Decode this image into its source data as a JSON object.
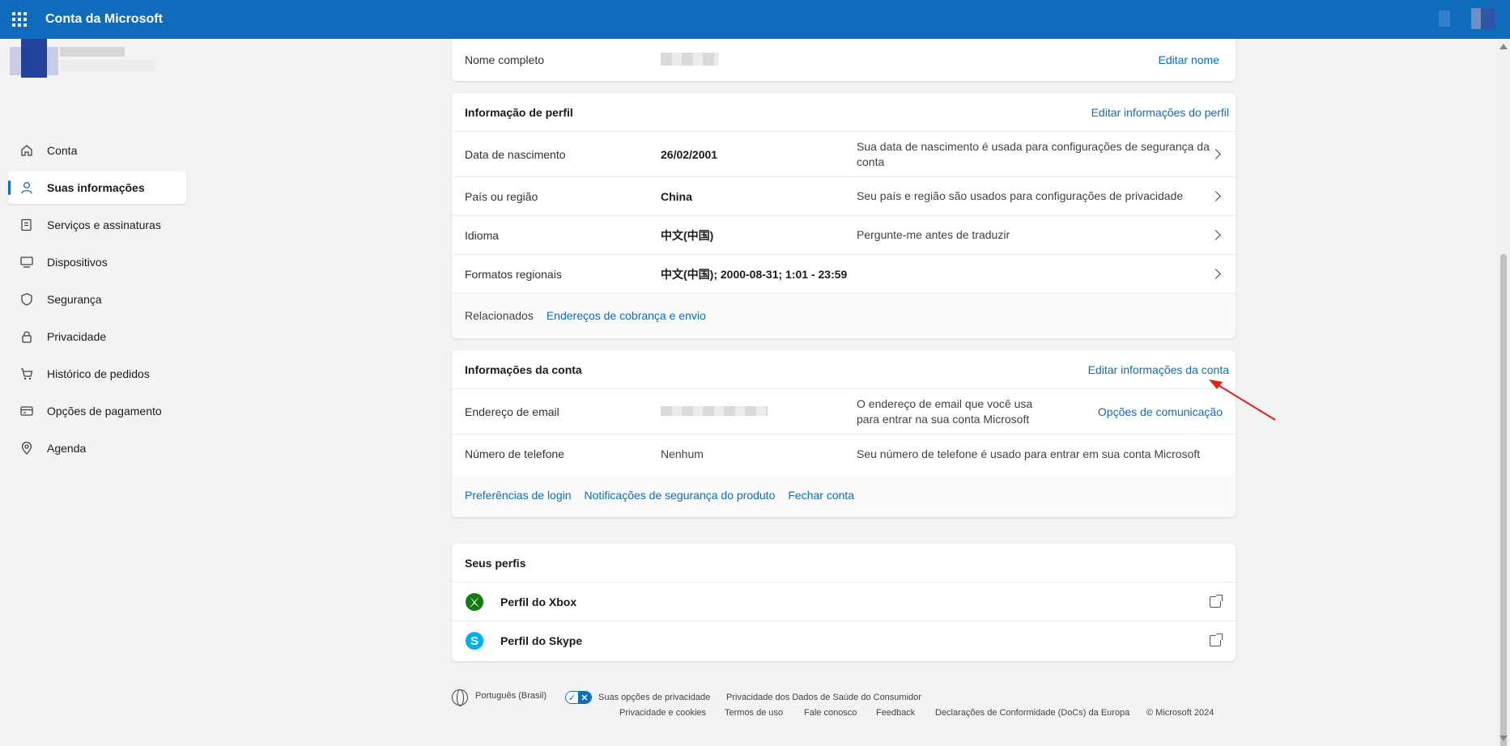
{
  "header": {
    "title": "Conta da Microsoft"
  },
  "sidebar": {
    "items": [
      {
        "label": "Conta",
        "icon": "home-icon"
      },
      {
        "label": "Suas informações",
        "icon": "person-icon",
        "active": true
      },
      {
        "label": "Serviços e assinaturas",
        "icon": "receipt-icon"
      },
      {
        "label": "Dispositivos",
        "icon": "laptop-icon"
      },
      {
        "label": "Segurança",
        "icon": "shield-icon"
      },
      {
        "label": "Privacidade",
        "icon": "lock-icon"
      },
      {
        "label": "Histórico de pedidos",
        "icon": "cart-icon"
      },
      {
        "label": "Opções de pagamento",
        "icon": "card-icon"
      },
      {
        "label": "Agenda",
        "icon": "location-icon"
      }
    ]
  },
  "name_card": {
    "label": "Nome completo",
    "edit": "Editar nome"
  },
  "profile_card": {
    "title": "Informação de perfil",
    "edit": "Editar informações do perfil",
    "rows": [
      {
        "label": "Data de nascimento",
        "value": "26/02/2001",
        "desc": "Sua data de nascimento é usada para configurações de segurança da conta"
      },
      {
        "label": "País ou região",
        "value": "China",
        "desc": "Seu país e região são usados para configurações de privacidade"
      },
      {
        "label": "Idioma",
        "value": "中文(中国)",
        "desc": "Pergunte-me antes de traduzir"
      },
      {
        "label": "Formatos regionais",
        "value": "中文(中国); 2000-08-31; 1:01 - 23:59",
        "desc": ""
      }
    ],
    "related_label": "Relacionados",
    "related_link": "Endereços de cobrança e envio"
  },
  "account_card": {
    "title": "Informações da conta",
    "edit": "Editar informações da conta",
    "email_label": "Endereço de email",
    "email_desc": "O endereço de email que você usa para entrar na sua conta Microsoft",
    "email_link": "Opções de comunicação",
    "phone_label": "Número de telefone",
    "phone_value": "Nenhum",
    "phone_desc": "Seu número de telefone é usado para entrar em sua conta Microsoft",
    "links": [
      "Preferências de login",
      "Notificações de segurança do produto",
      "Fechar conta"
    ]
  },
  "profiles_card": {
    "title": "Seus perfis",
    "items": [
      {
        "label": "Perfil do Xbox",
        "icon": "xbox-icon"
      },
      {
        "label": "Perfil do Skype",
        "icon": "skype-icon"
      }
    ]
  },
  "footer": {
    "language": "Português (Brasil)",
    "privacy_choices": "Suas opções de privacidade",
    "health_privacy": "Privacidade dos Dados de Saúde do Consumidor",
    "links": [
      "Privacidade e cookies",
      "Termos de uso",
      "Fale conosco",
      "Feedback",
      "Declarações de Conformidade (DoCs) da Europa"
    ],
    "copyright": "© Microsoft 2024"
  },
  "colors": {
    "accent": "#0f6cbd",
    "annotation": "#e0201b",
    "xbox": "#107c10",
    "skype": "#00aff0"
  }
}
